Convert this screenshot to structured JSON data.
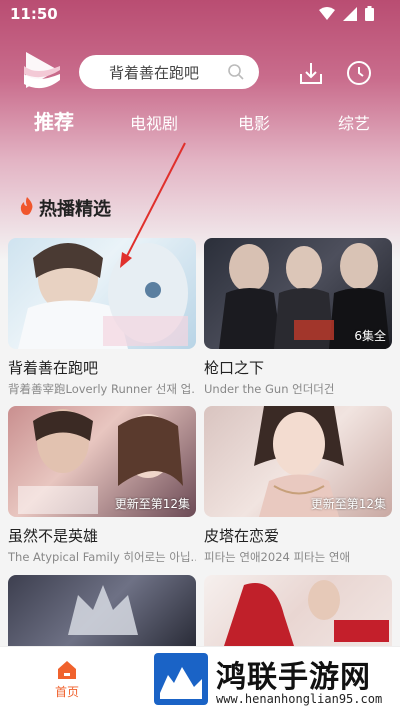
{
  "status": {
    "time": "11:50"
  },
  "header": {
    "search_placeholder": "背着善在跑吧",
    "tabs": [
      {
        "label": "推荐",
        "active": true
      },
      {
        "label": "电视剧"
      },
      {
        "label": "电影"
      },
      {
        "label": "综艺"
      }
    ]
  },
  "section": {
    "title": "热播精选"
  },
  "cards": [
    {
      "title": "背着善在跑吧",
      "subtitle": "背着善宰跑Loverly Runner 선재 업...",
      "badge": ""
    },
    {
      "title": "枪口之下",
      "subtitle": "Under the Gun 언더더건",
      "badge": "6集全"
    },
    {
      "title": "虽然不是英雄",
      "subtitle": "The Atypical Family 히어로는 아닙...",
      "badge": "更新至第12集"
    },
    {
      "title": "皮塔在恋爱",
      "subtitle": "피타는 연애2024 피타는 연애",
      "badge": "更新至第12集"
    }
  ],
  "bottom_nav": {
    "home_label": "首页"
  },
  "watermark": {
    "title": "鸿联手游网",
    "url": "www.henanhonglian95.com"
  },
  "colors": {
    "accent": "#f0622d",
    "header_top": "#b94d72",
    "annotation_arrow": "#e0302c"
  }
}
